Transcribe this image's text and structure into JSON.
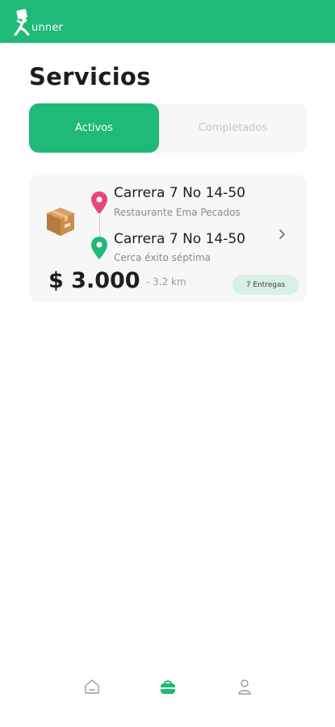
{
  "app": {
    "logo_text": "unner",
    "brand_color": "#1fb978"
  },
  "page": {
    "title": "Servicios"
  },
  "tabs": [
    {
      "label": "Activos",
      "active": true
    },
    {
      "label": "Completados",
      "active": false
    }
  ],
  "services": [
    {
      "icon": "package-icon",
      "origin": {
        "address": "Carrera 7 No 14-50",
        "place": "Restaurante Ema Pecados",
        "pin_color": "#e8467c"
      },
      "destination": {
        "address": "Carrera 7 No 14-50",
        "place": "Cerca éxito séptima",
        "pin_color": "#1fb978"
      },
      "price": "$ 3.000",
      "distance": "- 3.2 km",
      "deliveries": "7 Entregas"
    }
  ],
  "bottom_nav": {
    "items": [
      {
        "icon": "home-icon",
        "active": false
      },
      {
        "icon": "delivery-bag-icon",
        "active": true
      },
      {
        "icon": "user-icon",
        "active": false
      }
    ]
  }
}
